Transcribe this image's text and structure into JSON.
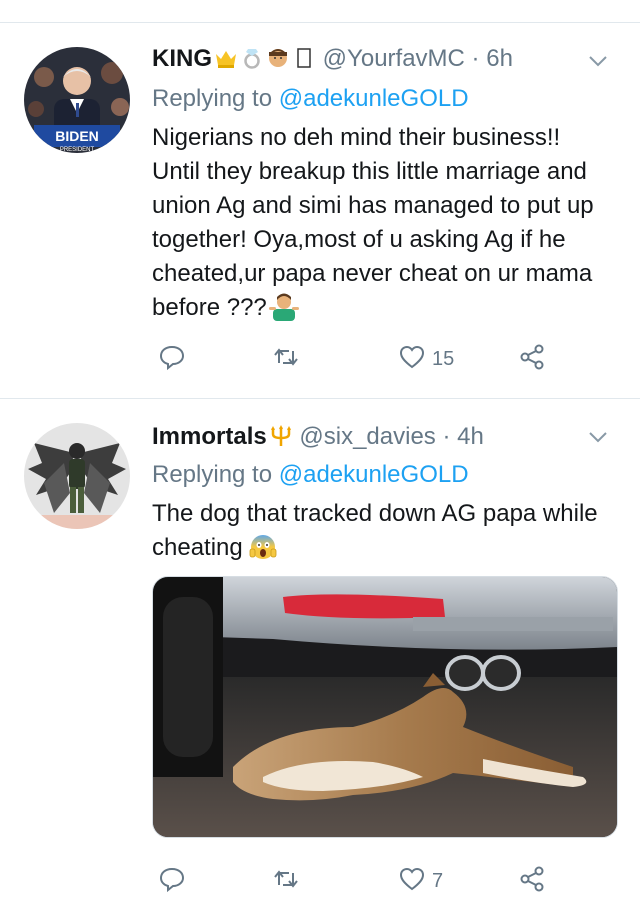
{
  "tweets": [
    {
      "name": "KING",
      "handle": "@YourfavMC",
      "dot": "·",
      "time": "6h",
      "replying_label": "Replying to",
      "replying_to": "@adekunleGOLD",
      "lines": [
        "Nigerians no deh mind their business!!",
        "Until they breakup this little marriage and",
        "union Ag and simi has managed to put up",
        "together! Oya,most of u asking Ag if he",
        "cheated,ur papa never cheat on ur mama",
        "before ???"
      ],
      "avatar_text": "BIDEN",
      "avatar_subtext": "PRESIDENT",
      "reply_count": "",
      "retweet_count": "",
      "like_count": "15"
    },
    {
      "name": "Immortals",
      "handle": "@six_davies",
      "dot": "·",
      "time": "4h",
      "replying_label": "Replying to",
      "replying_to": "@adekunleGOLD",
      "lines": [
        "The dog that tracked down AG papa while",
        "cheating"
      ],
      "reply_count": "",
      "retweet_count": "",
      "like_count": "7"
    }
  ],
  "colors": {
    "text": "#14171a",
    "secondary": "#657786",
    "accent": "#1da1f2",
    "divider": "#e1e8ed"
  },
  "icons": [
    "reply-icon",
    "retweet-icon",
    "like-icon",
    "share-icon",
    "chevron-down-icon"
  ]
}
